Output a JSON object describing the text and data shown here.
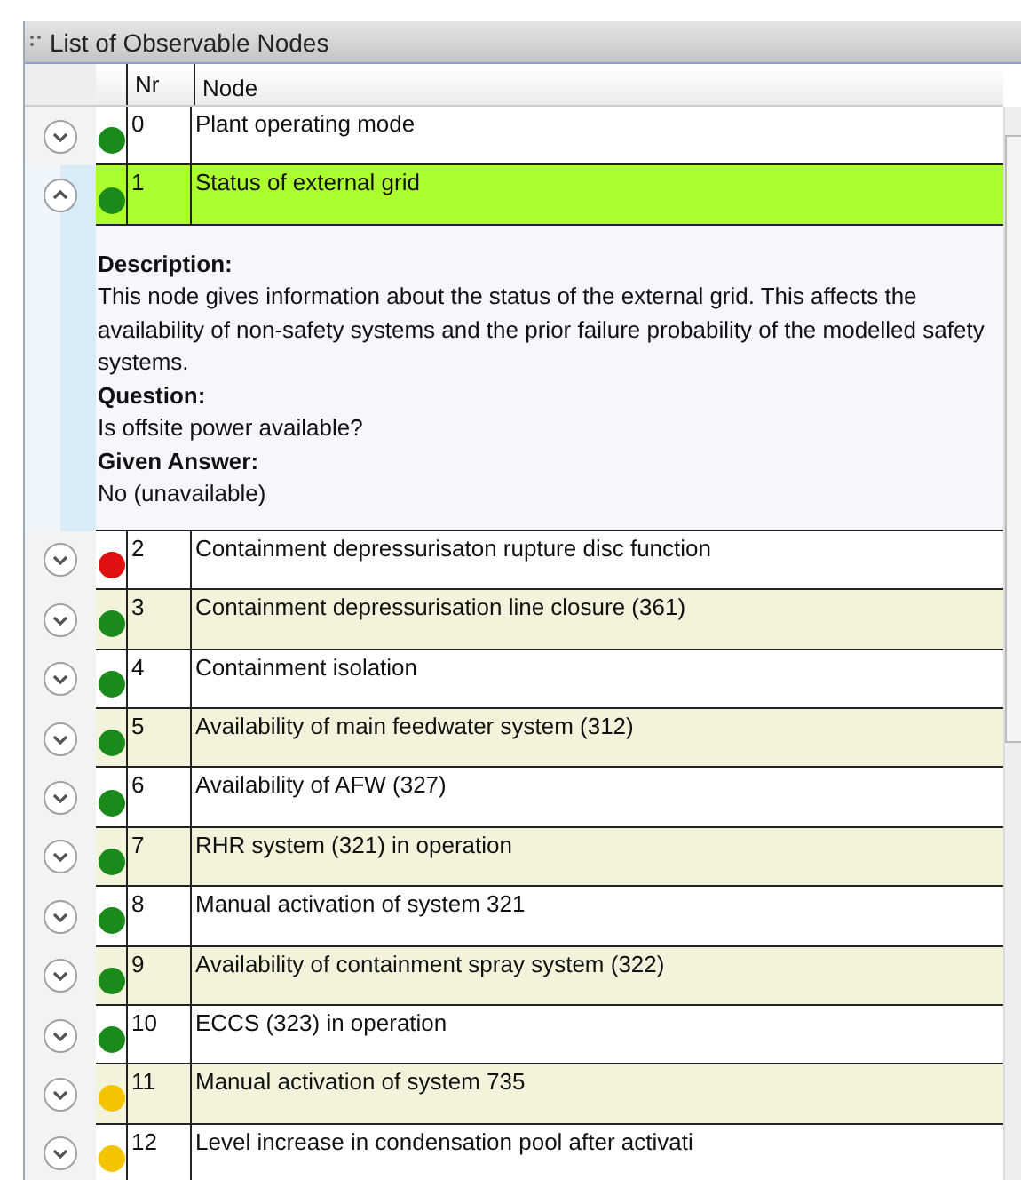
{
  "window": {
    "title": "List of Observable Nodes"
  },
  "columns": [
    "Nr",
    "Node"
  ],
  "rows": [
    {
      "nr": "0",
      "node": "Plant operating mode",
      "color": "#1a8a1a",
      "expanded": false,
      "selected": false
    },
    {
      "nr": "1",
      "node": "Status of external grid",
      "color": "#1a8a1a",
      "expanded": true,
      "selected": true,
      "details": [
        {
          "label": "Description:",
          "text": "This node gives information about the status of the external grid. This affects the availability of non-safety systems and the prior failure probability of the modelled safety systems."
        },
        {
          "label": "Question:",
          "text": "Is offsite power available?"
        },
        {
          "label": "Given Answer:",
          "text": "No (unavailable)"
        }
      ]
    },
    {
      "nr": "2",
      "node": "Containment depressurisaton rupture disc function",
      "color": "#e01010",
      "expanded": false,
      "selected": false
    },
    {
      "nr": "3",
      "node": "Containment depressurisation line closure (361)",
      "color": "#1a8a1a",
      "expanded": false,
      "selected": false
    },
    {
      "nr": "4",
      "node": "Containment isolation",
      "color": "#1a8a1a",
      "expanded": false,
      "selected": false
    },
    {
      "nr": "5",
      "node": "Availability of main feedwater system (312)",
      "color": "#1a8a1a",
      "expanded": false,
      "selected": false
    },
    {
      "nr": "6",
      "node": "Availability of AFW (327)",
      "color": "#1a8a1a",
      "expanded": false,
      "selected": false
    },
    {
      "nr": "7",
      "node": "RHR system (321) in operation",
      "color": "#1a8a1a",
      "expanded": false,
      "selected": false
    },
    {
      "nr": "8",
      "node": "Manual activation of system 321",
      "color": "#1a8a1a",
      "expanded": false,
      "selected": false
    },
    {
      "nr": "9",
      "node": "Availability of containment spray system (322)",
      "color": "#1a8a1a",
      "expanded": false,
      "selected": false
    },
    {
      "nr": "10",
      "node": "ECCS (323) in operation",
      "color": "#1a8a1a",
      "expanded": false,
      "selected": false
    },
    {
      "nr": "11",
      "node": "Manual activation of system 735",
      "color": "#f5c400",
      "expanded": false,
      "selected": false
    },
    {
      "nr": "12",
      "node": "Level increase in condensation pool after activati",
      "color": "#f5c400",
      "expanded": false,
      "selected": false
    }
  ]
}
